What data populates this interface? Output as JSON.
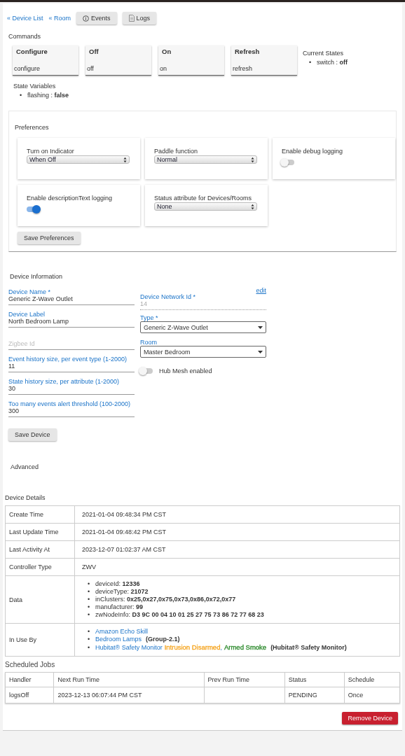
{
  "nav": {
    "links": [
      "« Device List",
      "« Room"
    ],
    "buttons": [
      {
        "label": "Events"
      },
      {
        "label": "Logs"
      }
    ]
  },
  "commands": {
    "title": "Commands",
    "items": [
      {
        "name": "Configure",
        "value": "configure"
      },
      {
        "name": "Off",
        "value": "off"
      },
      {
        "name": "On",
        "value": "on"
      },
      {
        "name": "Refresh",
        "value": "refresh"
      }
    ]
  },
  "current_states": {
    "title": "Current States",
    "items": [
      {
        "bullet": "•",
        "name": "switch :",
        "value": "off"
      }
    ]
  },
  "state_variables": {
    "title": "State Variables",
    "items": [
      {
        "bullet": "•",
        "name": "flashing :",
        "value": "false"
      }
    ]
  },
  "preferences": {
    "title": "Preferences",
    "items": [
      {
        "kind": "select",
        "label": "Turn on Indicator",
        "value": "When Off"
      },
      {
        "kind": "select",
        "label": "Paddle function",
        "value": "Normal"
      },
      {
        "kind": "toggle",
        "label": "Enable debug logging",
        "on": false
      },
      {
        "kind": "toggle",
        "label": "Enable descriptionText logging",
        "on": true
      },
      {
        "kind": "select",
        "label": "Status attribute for Devices/Rooms",
        "value": "None"
      }
    ],
    "save_button": "Save Preferences"
  },
  "device_information": {
    "title": "Device Information",
    "fields": [
      {
        "label": "Device Name *",
        "value": "Generic Z-Wave Outlet"
      },
      {
        "label": "Device Label",
        "value": "North Bedroom Lamp"
      },
      {
        "placeholder": "Zigbee Id"
      },
      {
        "label": "Event history size, per event type (1-2000)",
        "value": "11"
      },
      {
        "label": "State history size, per attribute (1-2000)",
        "value": "30"
      },
      {
        "label": "Too many events alert threshold (100-2000)",
        "value": "300"
      }
    ],
    "network_id": {
      "label": "Device Network Id *",
      "value": "14",
      "disabled": true,
      "edit_link": "edit"
    },
    "type": {
      "label": "Type *",
      "value": "Generic Z-Wave Outlet"
    },
    "room": {
      "label": "Room",
      "value": "Master Bedroom"
    },
    "hub_mesh": {
      "label": "Hub Mesh enabled",
      "on": false
    },
    "save_button": "Save Device"
  },
  "advanced": "Advanced",
  "device_details": {
    "title": "Device Details",
    "rows": [
      {
        "kind": "text",
        "label": "Create Time",
        "value": "2021-01-04 09:48:34 PM CST"
      },
      {
        "kind": "text",
        "label": "Last Update Time",
        "value": "2021-01-04 09:48:42 PM CST"
      },
      {
        "kind": "text",
        "label": "Last Activity At",
        "value": "2023-12-07 01:02:37 AM CST"
      },
      {
        "kind": "text",
        "label": "Controller Type",
        "value": "ZWV"
      },
      {
        "kind": "data",
        "label": "Data",
        "items": [
          {
            "bullet": "•",
            "key": "deviceId:",
            "value": "12336"
          },
          {
            "bullet": "•",
            "key": "deviceType:",
            "value": "21072"
          },
          {
            "bullet": "•",
            "key": "inClusters:",
            "value": "0x25,0x27,0x75,0x73,0x86,0x72,0x77"
          },
          {
            "bullet": "•",
            "key": "manufacturer:",
            "value": "99"
          },
          {
            "bullet": "•",
            "key": "zwNodeInfo:",
            "value": "D3 9C 00 04 10 01 25 27 75 73 86 72 77 68 23"
          }
        ]
      },
      {
        "kind": "apps",
        "label": "In Use By",
        "items": [
          {
            "bullet": "•",
            "link": "Amazon Echo Skill"
          },
          {
            "bullet": "•",
            "link": "Bedroom Lamps",
            "note": "(Group-2.1)"
          },
          {
            "bullet": "•",
            "link": "Hubitat® Safety Monitor",
            "statuses": [
              {
                "text": "Intrusion Disarmed",
                "color": "#f5a623"
              },
              {
                "text": "Armed Smoke",
                "color": "#2e8b2e"
              }
            ],
            "separator": ",",
            "note": "(Hubitat® Safety Monitor)"
          }
        ]
      }
    ]
  },
  "scheduled_jobs": {
    "title": "Scheduled Jobs",
    "columns": [
      "Handler",
      "Next Run Time",
      "Prev Run Time",
      "Status",
      "Schedule"
    ],
    "rows": [
      [
        "logsOff",
        "2023-12-13 06:07:44 PM CST",
        "",
        "PENDING",
        "Once"
      ]
    ]
  },
  "remove_button": "Remove Device"
}
